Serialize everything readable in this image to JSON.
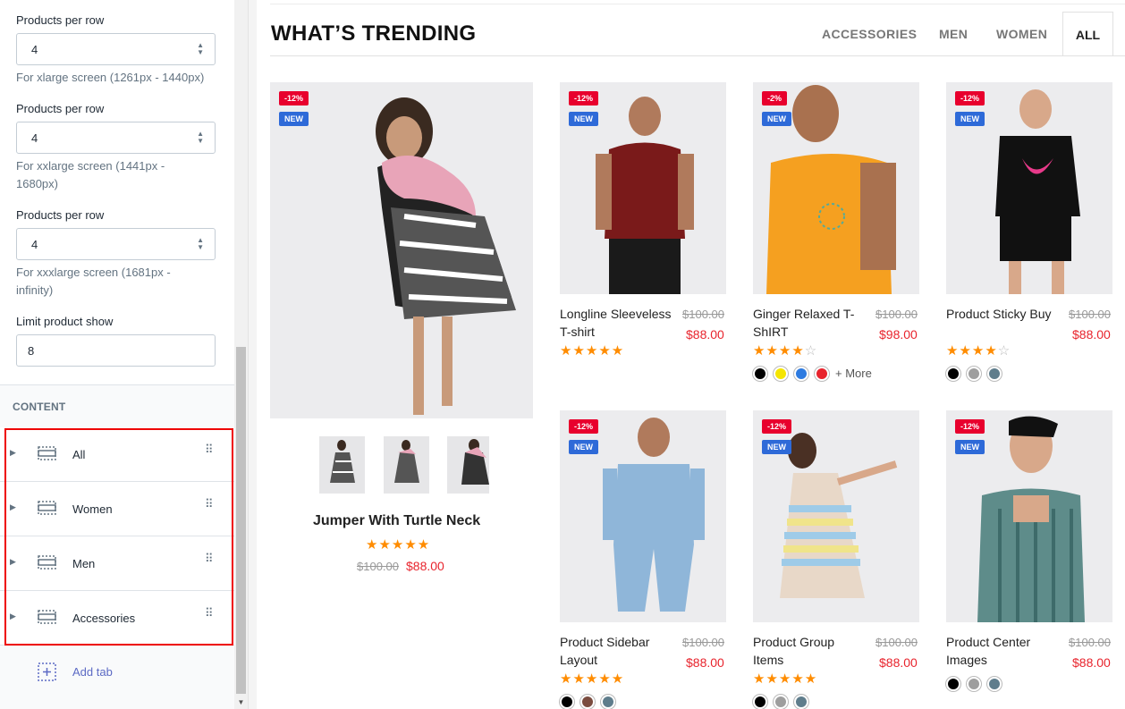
{
  "sidebar": {
    "settings": [
      {
        "label": "Products per row",
        "value": "4",
        "help": "For xlarge screen (1261px - 1440px)"
      },
      {
        "label": "Products per row",
        "value": "4",
        "help": "For xxlarge screen (1441px - 1680px)"
      },
      {
        "label": "Products per row",
        "value": "4",
        "help": "For xxxlarge screen (1681px - infinity)"
      }
    ],
    "limit": {
      "label": "Limit product show",
      "value": "8"
    },
    "content_heading": "CONTENT",
    "tabs": [
      {
        "label": "All"
      },
      {
        "label": "Women"
      },
      {
        "label": "Men"
      },
      {
        "label": "Accessories"
      }
    ],
    "add_tab": "Add tab"
  },
  "main": {
    "heading": "WHAT’S TRENDING",
    "filters": [
      {
        "label": "ACCESSORIES"
      },
      {
        "label": "MEN"
      },
      {
        "label": "WOMEN"
      },
      {
        "label": "ALL"
      }
    ],
    "featured": {
      "name": "Jumper With Turtle Neck",
      "old_price": "$100.00",
      "new_price": "$88.00",
      "rating": 5,
      "sale_badge": "-12%",
      "new_badge": "NEW"
    },
    "products": [
      {
        "name": "Longline Sleeveless T-shirt",
        "old_price": "$100.00",
        "new_price": "$88.00",
        "rating": 5,
        "sale_badge": "-12%",
        "new_badge": "NEW",
        "swatches": [],
        "more": ""
      },
      {
        "name": "Ginger Relaxed T-ShIRT",
        "old_price": "$100.00",
        "new_price": "$98.00",
        "rating": 4,
        "sale_badge": "-2%",
        "new_badge": "NEW",
        "swatches": [
          "#000000",
          "#f5e500",
          "#2e7be0",
          "#e8242d"
        ],
        "more": "+ More"
      },
      {
        "name": "Product Sticky Buy",
        "old_price": "$100.00",
        "new_price": "$88.00",
        "rating": 4,
        "sale_badge": "-12%",
        "new_badge": "NEW",
        "swatches": [
          "#000000",
          "#9e9e9e",
          "#5f7d8c"
        ],
        "more": ""
      },
      {
        "name": "Product Sidebar Layout",
        "old_price": "$100.00",
        "new_price": "$88.00",
        "rating": 5,
        "sale_badge": "-12%",
        "new_badge": "NEW",
        "swatches": [
          "#000000",
          "#7a4c3f",
          "#5f7d8c"
        ],
        "more": ""
      },
      {
        "name": "Product Group Items",
        "old_price": "$100.00",
        "new_price": "$88.00",
        "rating": 5,
        "sale_badge": "-12%",
        "new_badge": "NEW",
        "swatches": [
          "#000000",
          "#9e9e9e",
          "#5f7d8c"
        ],
        "more": ""
      },
      {
        "name": "Product Center Images",
        "old_price": "$100.00",
        "new_price": "$88.00",
        "rating": 0,
        "sale_badge": "-12%",
        "new_badge": "NEW",
        "swatches": [
          "#000000",
          "#9e9e9e",
          "#5f7d8c"
        ],
        "more": ""
      }
    ]
  },
  "colors": {
    "accent_red": "#e8242d",
    "badge_sale": "#e8002d",
    "badge_new": "#2e6ad8",
    "star": "#ff8c00",
    "link": "#5c6ac4"
  }
}
